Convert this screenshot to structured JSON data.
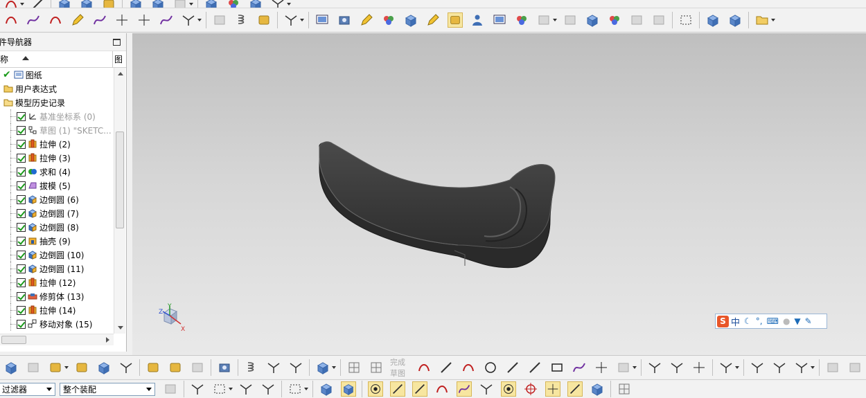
{
  "navigator": {
    "title": "件导航器",
    "columns": {
      "name": "称",
      "other": "图"
    },
    "rows": [
      {
        "label": "图纸",
        "icon": "drawing-sheet-icon",
        "level": 0,
        "dim": false,
        "checked": true
      },
      {
        "label": "用户表达式",
        "icon": "folder-icon",
        "level": 0,
        "dim": false,
        "checked": false
      },
      {
        "label": "模型历史记录",
        "icon": "folder-open-icon",
        "level": 0,
        "dim": false,
        "checked": false
      },
      {
        "label": "基准坐标系 (0)",
        "icon": "datum-csys-icon",
        "level": 1,
        "dim": true,
        "checked": true
      },
      {
        "label": "草图 (1) \"SKETC...",
        "icon": "sketch-icon",
        "level": 1,
        "dim": true,
        "checked": true
      },
      {
        "label": "拉伸 (2)",
        "icon": "extrude-icon",
        "level": 1,
        "dim": false,
        "checked": true
      },
      {
        "label": "拉伸 (3)",
        "icon": "extrude-icon",
        "level": 1,
        "dim": false,
        "checked": true
      },
      {
        "label": "求和 (4)",
        "icon": "unite-icon",
        "level": 1,
        "dim": false,
        "checked": true
      },
      {
        "label": "拔模 (5)",
        "icon": "draft-icon",
        "level": 1,
        "dim": false,
        "checked": true
      },
      {
        "label": "边倒圆 (6)",
        "icon": "edge-blend-icon",
        "level": 1,
        "dim": false,
        "checked": true
      },
      {
        "label": "边倒圆 (7)",
        "icon": "edge-blend-icon",
        "level": 1,
        "dim": false,
        "checked": true
      },
      {
        "label": "边倒圆 (8)",
        "icon": "edge-blend-icon",
        "level": 1,
        "dim": false,
        "checked": true
      },
      {
        "label": "抽壳 (9)",
        "icon": "shell-icon",
        "level": 1,
        "dim": false,
        "checked": true
      },
      {
        "label": "边倒圆 (10)",
        "icon": "edge-blend-icon",
        "level": 1,
        "dim": false,
        "checked": true
      },
      {
        "label": "边倒圆 (11)",
        "icon": "edge-blend-icon",
        "level": 1,
        "dim": false,
        "checked": true
      },
      {
        "label": "拉伸 (12)",
        "icon": "extrude-icon",
        "level": 1,
        "dim": false,
        "checked": true
      },
      {
        "label": "修剪体 (13)",
        "icon": "trim-body-icon",
        "level": 1,
        "dim": false,
        "checked": true
      },
      {
        "label": "拉伸 (14)",
        "icon": "extrude-icon",
        "level": 1,
        "dim": false,
        "checked": true
      },
      {
        "label": "移动对象 (15)",
        "icon": "move-object-icon",
        "level": 1,
        "dim": false,
        "checked": true
      }
    ]
  },
  "viewport": {
    "model": "curved-solid-part",
    "triad": {
      "x": "X",
      "y": "Y",
      "z": "Z"
    },
    "ime": {
      "logo": "S",
      "lang": "中"
    }
  },
  "sketch_toolbar": {
    "finish_sketch": "完成草图"
  },
  "selection_bar": {
    "filter": "过滤器",
    "scope": "整个装配"
  },
  "colors": {
    "accent_orange": "#e8562a",
    "model": "#3c3c3c",
    "viewport_top": "#bfbfbf",
    "viewport_bottom": "#e9e9e9"
  }
}
